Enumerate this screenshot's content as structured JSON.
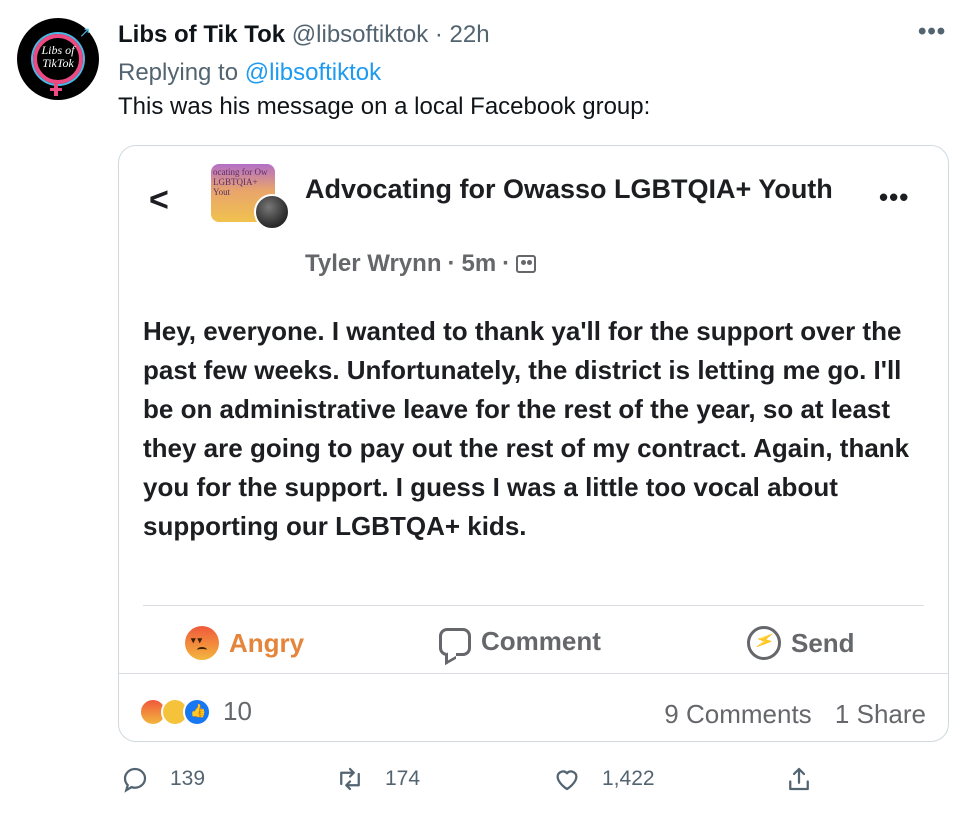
{
  "tweet": {
    "author_name": "Libs of Tik Tok",
    "handle": "@libsoftiktok",
    "separator": "·",
    "time": "22h",
    "more_label": "•••",
    "reply_prefix": "Replying to",
    "reply_to": "@libsoftiktok",
    "text": "This was his message on a local Facebook group:",
    "avatar_text": "Libs of TikTok"
  },
  "fb_post": {
    "back_label": "<",
    "thumb_text": "ocating for Ow LGBTQIA+ Yout",
    "group_name": "Advocating for Owasso LGBTQIA+ Youth",
    "more_label": "•••",
    "author": "Tyler Wrynn",
    "meta_sep1": "·",
    "time": "5m",
    "meta_sep2": "·",
    "body": "Hey, everyone. I wanted to thank ya'll for the support over the past few weeks. Unfortunately, the district is letting me go. I'll be on administrative leave for the rest of the year, so at least they are going to pay out the rest of my contract. Again, thank you for the support. I guess I was a little too vocal about supporting our LGBTQA+ kids.",
    "actions": {
      "angry": "Angry",
      "comment": "Comment",
      "send": "Send"
    },
    "reaction_count": "10",
    "comments": "9 Comments",
    "shares": "1 Share"
  },
  "tweet_actions": {
    "replies": "139",
    "retweets": "174",
    "likes": "1,422"
  },
  "icons": {
    "reply": "reply-icon",
    "retweet": "retweet-icon",
    "like": "heart-icon",
    "share": "share-icon"
  },
  "colors": {
    "link": "#1d9bf0",
    "secondary": "#536471",
    "angry": "#e4853b"
  }
}
